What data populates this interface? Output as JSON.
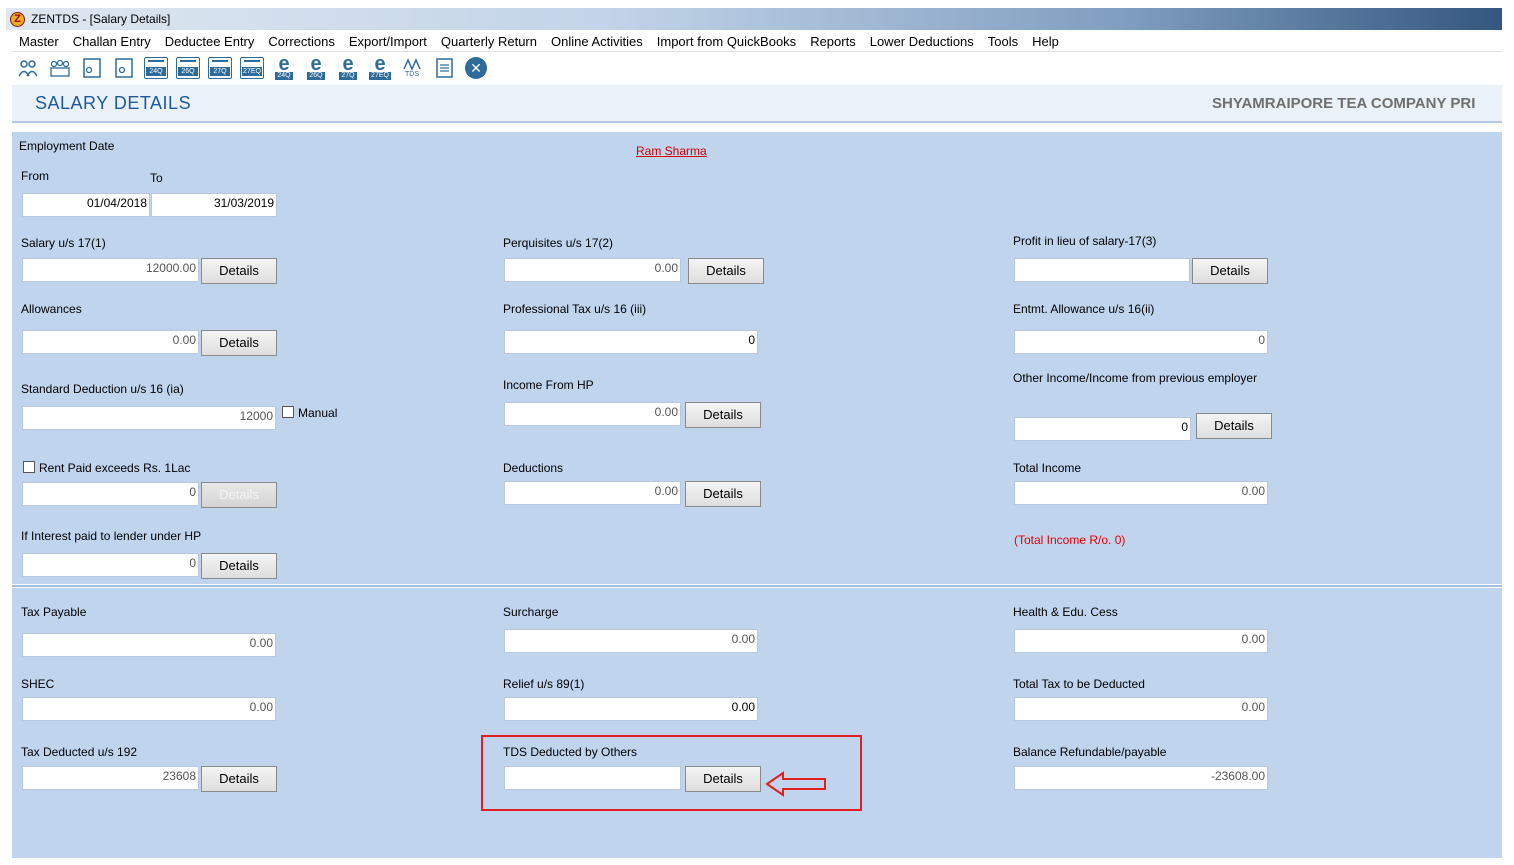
{
  "window": {
    "title": "ZENTDS - [Salary Details]"
  },
  "menu": [
    "Master",
    "Challan Entry",
    "Deductee Entry",
    "Corrections",
    "Export/Import",
    "Quarterly Return",
    "Online Activities",
    "Import from QuickBooks",
    "Reports",
    "Lower Deductions",
    "Tools",
    "Help"
  ],
  "toolbar": {
    "forms": [
      "24Q",
      "26Q",
      "27Q",
      "27EQ"
    ],
    "e_forms": [
      "24Q",
      "26Q",
      "27Q",
      "27EQ"
    ],
    "tds_label": "TDS"
  },
  "header": {
    "title": "SALARY DETAILS",
    "company": "SHYAMRAIPORE TEA COMPANY PRI"
  },
  "employee": {
    "name": "Ram Sharma"
  },
  "employment": {
    "label": "Employment Date",
    "from_label": "From",
    "to_label": "To",
    "from": "01/04/2018",
    "to": "31/03/2019"
  },
  "details_label": "Details",
  "fields": {
    "salary": {
      "label": "Salary u/s 17(1)",
      "value": "12000.00"
    },
    "perquisites": {
      "label": "Perquisites u/s 17(2)",
      "value": "0.00"
    },
    "profit": {
      "label": "Profit in lieu of salary-17(3)",
      "value": ""
    },
    "allowances": {
      "label": "Allowances",
      "value": "0.00"
    },
    "prof_tax": {
      "label": "Professional Tax u/s 16 (iii)",
      "value": "0"
    },
    "entmt": {
      "label": "Entmt. Allowance u/s 16(ii)",
      "value": "0"
    },
    "std_ded": {
      "label": "Standard Deduction u/s 16 (ia)",
      "value": "12000",
      "manual_label": "Manual"
    },
    "income_hp": {
      "label": "Income From HP",
      "value": "0.00"
    },
    "other_income": {
      "label": "Other Income/Income from previous employer",
      "value": "0"
    },
    "rent": {
      "label": "Rent Paid exceeds Rs.  1Lac",
      "value": "0"
    },
    "deductions": {
      "label": "Deductions",
      "value": "0.00"
    },
    "total_income": {
      "label": "Total Income",
      "value": "0.00",
      "note": "(Total Income R/o. 0)"
    },
    "interest_hp": {
      "label": "If Interest paid to lender under HP",
      "value": "0"
    },
    "tax_payable": {
      "label": "Tax Payable",
      "value": "0.00"
    },
    "surcharge": {
      "label": "Surcharge",
      "value": "0.00"
    },
    "cess": {
      "label": "Health & Edu. Cess",
      "value": "0.00"
    },
    "shec": {
      "label": "SHEC",
      "value": "0.00"
    },
    "relief": {
      "label": "Relief u/s 89(1)",
      "value": "0.00"
    },
    "total_tax": {
      "label": "Total Tax to be Deducted",
      "value": "0.00"
    },
    "tax_192": {
      "label": "Tax Deducted u/s 192",
      "value": "23608"
    },
    "tds_others": {
      "label": "TDS Deducted by Others",
      "value": ""
    },
    "balance": {
      "label": "Balance Refundable/payable",
      "value": "-23608.00"
    }
  },
  "colors": {
    "panel": "#c0d4ee",
    "title": "#1e5a9c",
    "highlight": "#e02020"
  }
}
